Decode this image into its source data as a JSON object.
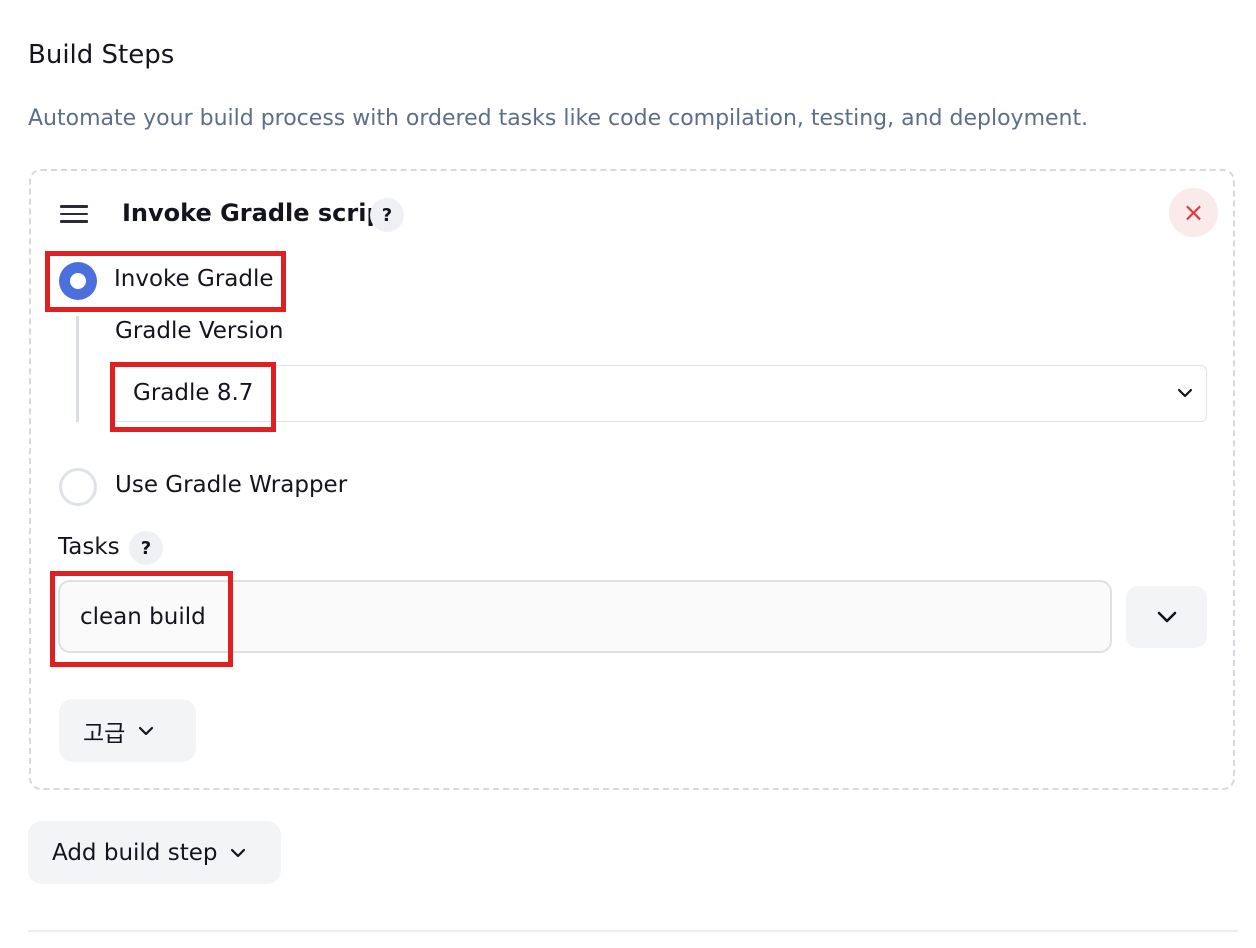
{
  "section": {
    "title": "Build Steps",
    "description": "Automate your build process with ordered tasks like code compilation, testing, and deployment."
  },
  "step": {
    "title": "Invoke Gradle script",
    "help": "?",
    "close": "×",
    "options": {
      "invoke_gradle": {
        "label": "Invoke Gradle",
        "selected": true
      },
      "wrapper": {
        "label": "Use Gradle Wrapper",
        "selected": false
      }
    },
    "gradle_version": {
      "label": "Gradle Version",
      "value": "Gradle 8.7"
    },
    "tasks": {
      "label": "Tasks",
      "help": "?",
      "value": "clean build"
    },
    "advanced_label": "고급"
  },
  "add_step_label": "Add build step",
  "icons": {
    "drag": "drag-handle-icon",
    "close": "close-icon",
    "chevron": "chevron-down-icon"
  },
  "colors": {
    "accent": "#4c6fde",
    "description": "#5d6e8c",
    "close": "#e0383e",
    "highlight": "#e02020"
  }
}
